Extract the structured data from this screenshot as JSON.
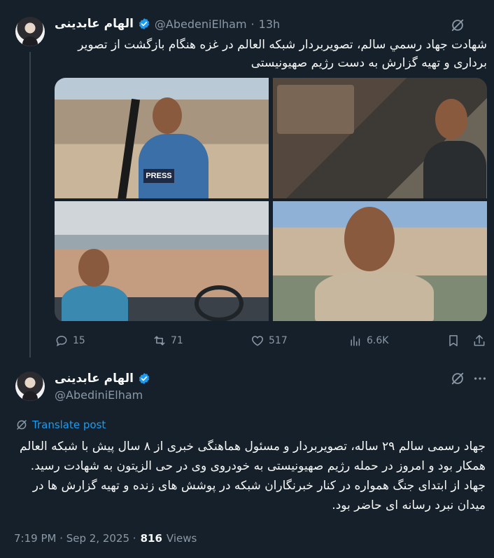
{
  "tweet1": {
    "author_name": "الهام عابدینی",
    "handle": "@AbedeniElham",
    "separator": "·",
    "time": "13h",
    "text_line1": "شهادت جهاد رسمي سالم، تصویربردار شبکه العالم در غزه هنگام بازگشت از تصویر",
    "text_line2": "برداری و تهیه گزارش به دست رژیم صهیونیستی",
    "press_label": "PRESS",
    "stats": {
      "replies": "15",
      "reposts": "71",
      "likes": "517",
      "views": "6.6K"
    }
  },
  "tweet2": {
    "author_name": "الهام عابدینی",
    "handle": "@AbediniElham",
    "translate_label": "Translate post",
    "body": "جهاد رسمی سالم ۲۹ ساله، تصویربردار و مسئول هماهنگی خبری از ۸ سال پیش با شبکه العالم همکار بود و امروز در حمله رژیم صهیونیستی به خودروی وی در حی الزیتون به شهادت رسید. جهاد از ابتدای جنگ همواره در کنار خبرنگاران شبکه در پوشش های زنده و تهیه گزارش ها در میدان نبرد رسانه ای حاضر بود.",
    "timestamp": "7:19 PM · Sep 2, 2025 ·",
    "views_count": "816",
    "views_label": "Views"
  },
  "icons": {
    "verified": "verified-badge-icon",
    "grok": "grok-icon",
    "more": "more-icon",
    "reply": "reply-icon",
    "repost": "repost-icon",
    "like": "like-icon",
    "views": "views-icon",
    "bookmark": "bookmark-icon",
    "share": "share-icon",
    "translate": "translate-icon"
  },
  "colors": {
    "background": "#15202b",
    "text": "#f7f9f9",
    "muted": "#8b98a5",
    "accent": "#1d9bf0"
  }
}
